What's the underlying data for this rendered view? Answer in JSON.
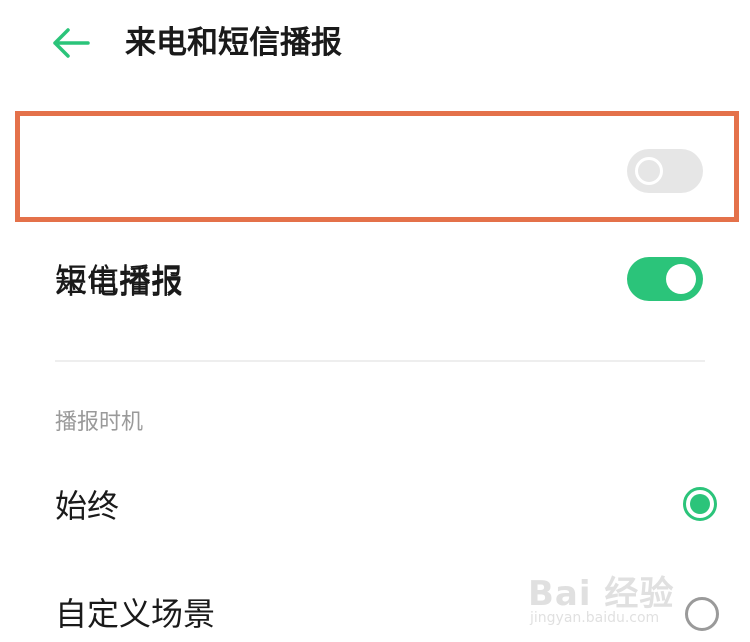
{
  "header": {
    "title": "来电和短信播报",
    "back_icon": "arrow-left-icon"
  },
  "colors": {
    "accent": "#2bc47a",
    "highlight_border": "#e4714a",
    "toggle_off": "#e6e6e6",
    "section_label": "#9a9a9a"
  },
  "settings": {
    "incoming_call": {
      "label": "来电播报",
      "enabled": false
    },
    "sms": {
      "label": "短信播报",
      "enabled": true
    }
  },
  "timing": {
    "section_label": "播报时机",
    "options": [
      {
        "label": "始终",
        "selected": true
      },
      {
        "label": "自定义场景",
        "selected": false
      }
    ]
  },
  "watermark": {
    "brand": "Bai 经验",
    "url": "jingyan.baidu.com"
  }
}
